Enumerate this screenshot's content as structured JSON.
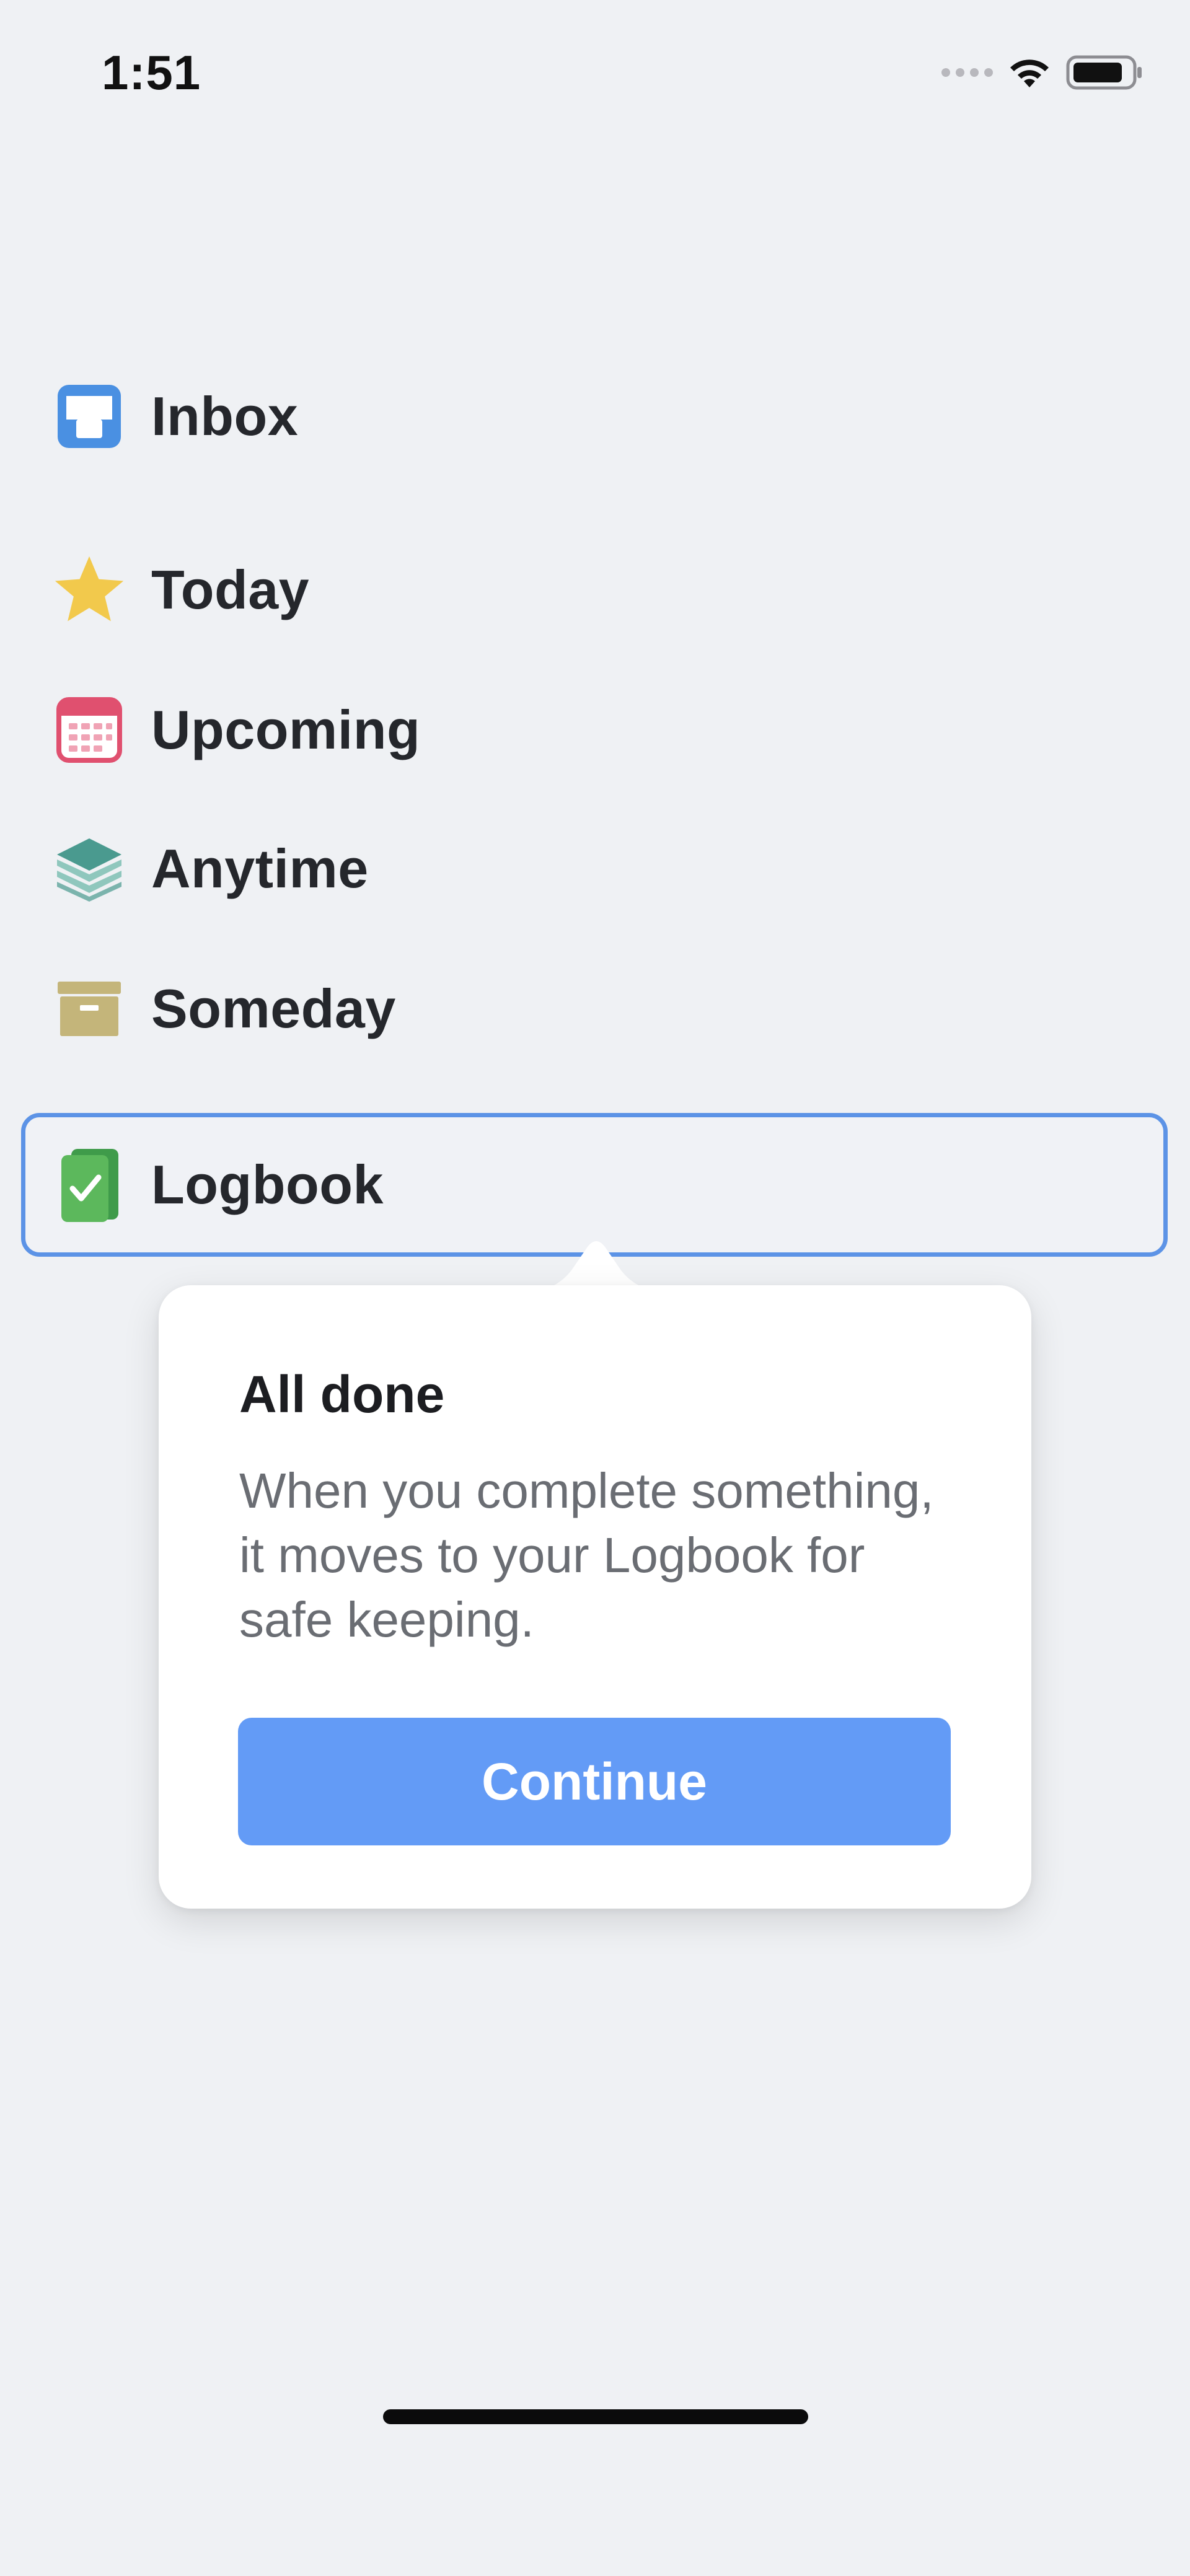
{
  "status_bar": {
    "time": "1:51"
  },
  "nav": {
    "items": [
      {
        "label": "Inbox",
        "icon": "inbox-icon"
      },
      {
        "label": "Today",
        "icon": "star-icon"
      },
      {
        "label": "Upcoming",
        "icon": "calendar-icon"
      },
      {
        "label": "Anytime",
        "icon": "layers-icon"
      },
      {
        "label": "Someday",
        "icon": "archive-box-icon"
      },
      {
        "label": "Logbook",
        "icon": "logbook-icon",
        "selected": true
      }
    ]
  },
  "popover": {
    "title": "All done",
    "body": "When you complete something, it moves to your Logbook for safe keeping.",
    "button_label": "Continue"
  },
  "colors": {
    "background": "#eff1f4",
    "accent": "#639bf6",
    "selection_border": "#5c93e6",
    "inbox_blue": "#4a90e2",
    "today_yellow": "#f2c94c",
    "upcoming_red": "#e0506f",
    "anytime_teal": "#4a9a8f",
    "someday_tan": "#c4b57a",
    "logbook_green": "#5cb85c"
  }
}
